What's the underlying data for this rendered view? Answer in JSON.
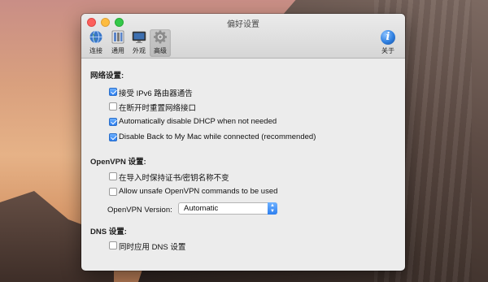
{
  "window": {
    "title": "偏好设置"
  },
  "toolbar": {
    "items": [
      {
        "label": "连接",
        "icon": "globe-connect-icon"
      },
      {
        "label": "通用",
        "icon": "general-switch-icon"
      },
      {
        "label": "外观",
        "icon": "monitor-appearance-icon"
      },
      {
        "label": "高级",
        "icon": "gear-icon",
        "selected": true
      }
    ],
    "about": {
      "label": "关于",
      "icon": "info-icon",
      "glyph": "i"
    }
  },
  "network": {
    "heading": "网络设置:",
    "options": [
      {
        "label": "接受 IPv6 路由器通告",
        "checked": true
      },
      {
        "label": "在断开时重置网络接口",
        "checked": false
      },
      {
        "label": "Automatically disable DHCP when not needed",
        "checked": true
      },
      {
        "label": "Disable Back to My Mac while connected (recommended)",
        "checked": true
      }
    ]
  },
  "openvpn": {
    "heading": "OpenVPN 设置:",
    "options": [
      {
        "label": "在导入时保持证书/密钥名称不变",
        "checked": false
      },
      {
        "label": "Allow unsafe OpenVPN commands to be used",
        "checked": false
      }
    ],
    "version_label": "OpenVPN Version:",
    "version_value": "Automatic"
  },
  "dns": {
    "heading": "DNS 设置:",
    "options": [
      {
        "label": "同时应用 DNS 设置",
        "checked": false
      }
    ]
  },
  "colors": {
    "checkbox_accent": "#2d7ff0",
    "close": "#fc605c",
    "minimize": "#fdbc40",
    "maximize": "#34c84a"
  }
}
